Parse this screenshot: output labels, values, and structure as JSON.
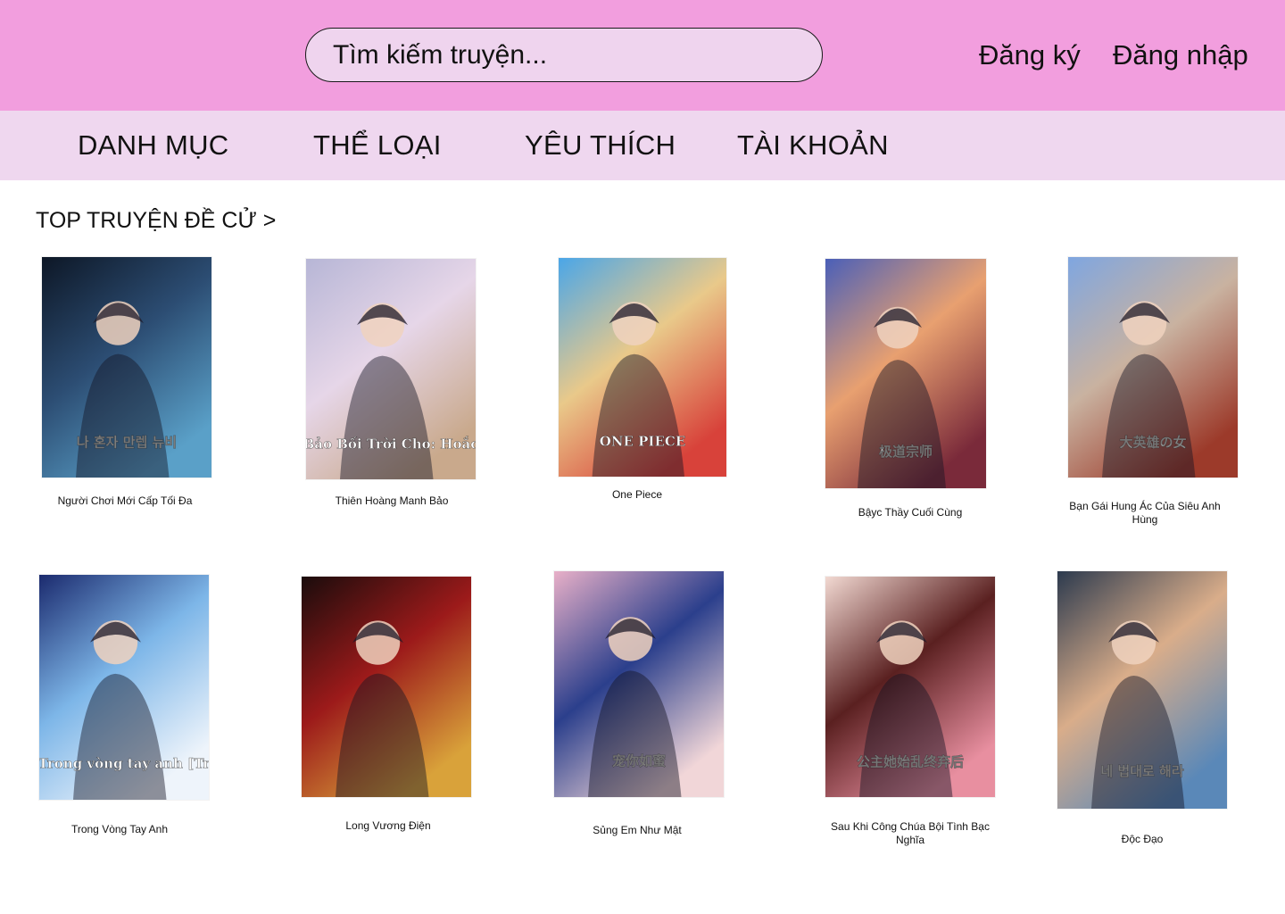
{
  "header": {
    "search_placeholder": "Tìm kiếm truyện...",
    "register_label": "Đăng ký",
    "login_label": "Đăng nhập"
  },
  "nav": {
    "items": [
      {
        "label": "DANH MỤC"
      },
      {
        "label": "THỂ LOẠI"
      },
      {
        "label": "YÊU THÍCH"
      },
      {
        "label": "TÀI KHOẢN"
      }
    ]
  },
  "section": {
    "title": "TOP TRUYỆN ĐỀ CỬ >"
  },
  "comics": [
    {
      "title": "Người Chơi Mới Cấp Tối Đa",
      "cover_text": "나 혼자 만렙 뉴비",
      "colors": [
        "#0d1726",
        "#2c4d73",
        "#5aa0c8"
      ]
    },
    {
      "title": "Thiên Hoàng Manh Bảo",
      "cover_text": "Bảo Bối Trời Cho: Hoắc Gia Xin Ký Nhận",
      "colors": [
        "#b7b6d6",
        "#e6d6e8",
        "#c9a98c"
      ]
    },
    {
      "title": "One Piece",
      "cover_text": "ONE PIECE",
      "colors": [
        "#4aa6e8",
        "#e9c98a",
        "#d8423a"
      ]
    },
    {
      "title": "Bậyc Thầy Cuối Cùng",
      "cover_text": "极道宗师",
      "colors": [
        "#4a5fb8",
        "#e8a070",
        "#7a2a3a"
      ]
    },
    {
      "title": "Bạn Gái Hung Ác Của Siêu Anh Hùng",
      "cover_text": "大英雄の女",
      "colors": [
        "#7fa6e0",
        "#c9b2a0",
        "#9c3a2a"
      ]
    },
    {
      "title": "Trong Vòng Tay Anh",
      "cover_text": "Trong vòng tay anh [Trùng sinh]",
      "colors": [
        "#1b2a6e",
        "#7db6e8",
        "#eef4fb"
      ]
    },
    {
      "title": "Long Vương Điện",
      "cover_text": "",
      "colors": [
        "#1a0c0c",
        "#9c1a1a",
        "#d9a23a"
      ]
    },
    {
      "title": "Sủng Em Như Mật",
      "cover_text": "宠你如蜜",
      "colors": [
        "#e8b0c8",
        "#2b3f8c",
        "#f1d6d8"
      ]
    },
    {
      "title": "Sau Khi Công Chúa Bội Tình Bạc Nghĩa",
      "cover_text": "公主她始乱终弃后",
      "colors": [
        "#f2d9d2",
        "#5a2020",
        "#e88fa0"
      ]
    },
    {
      "title": "Độc Đạo",
      "cover_text": "네 법대로 해라",
      "colors": [
        "#2c3a4e",
        "#d9ad8a",
        "#5a88b8"
      ]
    }
  ]
}
